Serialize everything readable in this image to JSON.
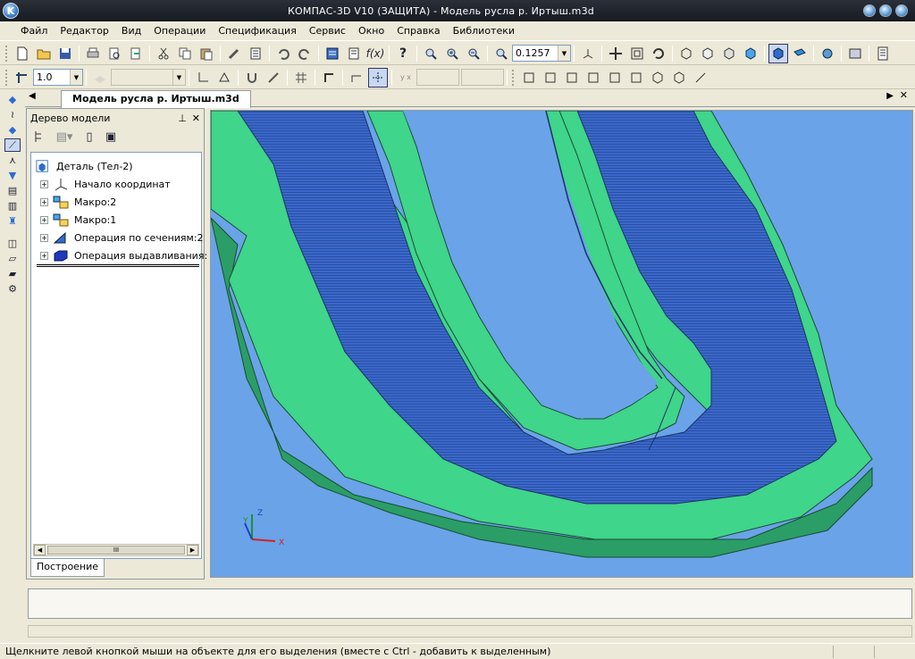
{
  "window": {
    "title": "КОМПАС-3D V10 (ЗАЩИТА) - Модель русла р. Иртыш.m3d",
    "logo": "K"
  },
  "menu": [
    "Файл",
    "Редактор",
    "Вид",
    "Операции",
    "Спецификация",
    "Сервис",
    "Окно",
    "Справка",
    "Библиотеки"
  ],
  "toolbar": {
    "zoom_value": "0.1257",
    "line_step": "1.0"
  },
  "document_tab": {
    "label": "Модель русла р. Иртыш.m3d"
  },
  "tree": {
    "title": "Дерево модели",
    "root": "Деталь (Тел-2)",
    "items": [
      "Начало координат",
      "Макро:2",
      "Макро:1",
      "Операция по сечениям:2",
      "Операция выдавливания:"
    ],
    "bottom_tab": "Построение",
    "scroll_thumb": "III"
  },
  "axes": {
    "x": "X",
    "y": "Y",
    "z": "Z"
  },
  "status": {
    "text": "Щелкните левой кнопкой мыши на объекте для его выделения (вместе с Ctrl - добавить к выделенным)"
  },
  "colors": {
    "accent": "#2f6bd1",
    "model_green": "#3fd58a",
    "model_blue": "#3d68c4",
    "background_blue": "#6aa3e8"
  },
  "icons": [
    "new-icon",
    "open-icon",
    "save-icon",
    "print-icon",
    "preview-icon",
    "cut-icon",
    "copy-icon",
    "paste-icon",
    "properties-icon",
    "undo-icon",
    "redo-icon",
    "variables-icon",
    "help-icon",
    "zoom-icon",
    "rotate-icon",
    "orient-icon"
  ]
}
